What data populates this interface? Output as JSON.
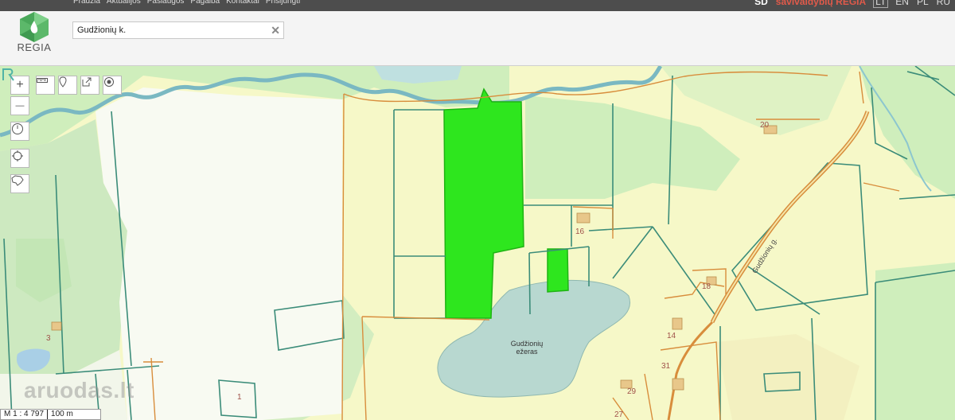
{
  "topbar": {
    "nav": [
      "Pradžia",
      "Aktualijos",
      "Paslaugos",
      "Pagalba",
      "Kontaktai",
      "Prisijungti"
    ],
    "code": "SD",
    "brand": "savivaldybių REGIA",
    "languages": [
      "LT",
      "EN",
      "PL",
      "RU"
    ]
  },
  "header": {
    "logo_text": "REGIA",
    "search": {
      "value": "Gudžionių k.",
      "clear": "✕"
    }
  },
  "toolbar": {
    "zoom_in": "+",
    "zoom_out": "—",
    "tools": [
      "ruler-icon",
      "marker-icon",
      "share-icon",
      "locate-icon"
    ]
  },
  "side_tools": [
    "clock-icon",
    "crosshair-icon",
    "shape-icon"
  ],
  "map": {
    "lake_name": "Gudžionių",
    "lake_suffix": "ežeras",
    "road_name": "Gudžionių g.",
    "parcel_numbers": [
      "20",
      "16",
      "18",
      "3",
      "14",
      "31",
      "29",
      "27",
      "1"
    ],
    "colors": {
      "highlight": "#2ee61e",
      "water": "#b8d8d0",
      "forest": "#cfeebc",
      "parcel_border": "#3b8c79",
      "road": "#d88d3c"
    }
  },
  "scale": {
    "ratio": "M 1 : 4 797",
    "distance": "100 m"
  },
  "watermark": "aruodas.lt"
}
